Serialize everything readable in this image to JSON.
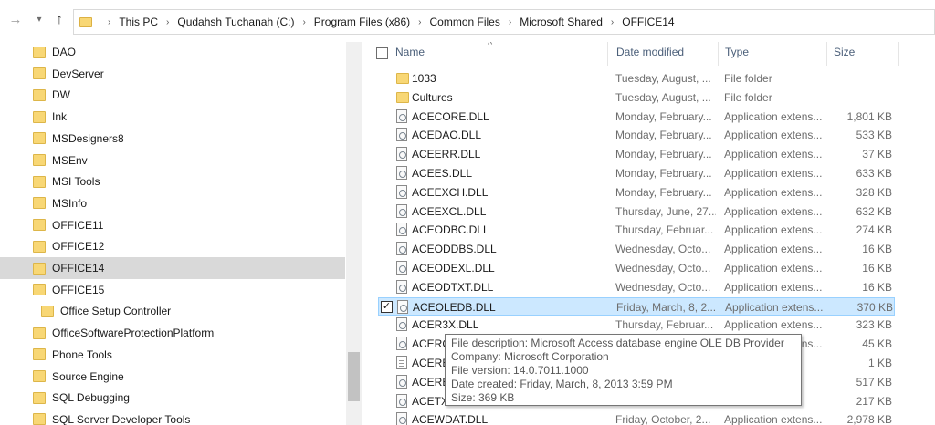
{
  "address": {
    "crumbs": [
      "This PC",
      "Qudahsh Tuchanah (C:)",
      "Program Files (x86)",
      "Common Files",
      "Microsoft Shared",
      "OFFICE14"
    ]
  },
  "nav_items": [
    {
      "label": "DAO"
    },
    {
      "label": "DevServer"
    },
    {
      "label": "DW"
    },
    {
      "label": "Ink"
    },
    {
      "label": "MSDesigners8"
    },
    {
      "label": "MSEnv"
    },
    {
      "label": "MSI Tools"
    },
    {
      "label": "MSInfo"
    },
    {
      "label": "OFFICE11"
    },
    {
      "label": "OFFICE12"
    },
    {
      "label": "OFFICE14",
      "selected": true
    },
    {
      "label": "OFFICE15"
    },
    {
      "label": "Office Setup Controller",
      "indent": true
    },
    {
      "label": "OfficeSoftwareProtectionPlatform"
    },
    {
      "label": "Phone Tools"
    },
    {
      "label": "Source Engine"
    },
    {
      "label": "SQL Debugging"
    },
    {
      "label": "SQL Server Developer Tools"
    }
  ],
  "columns": {
    "name": "Name",
    "date": "Date modified",
    "type": "Type",
    "size": "Size"
  },
  "files": [
    {
      "icon": "folder-icon",
      "name": "1033",
      "date": "Tuesday, August, ...",
      "type": "File folder",
      "size": ""
    },
    {
      "icon": "folder-icon",
      "name": "Cultures",
      "date": "Tuesday, August, ...",
      "type": "File folder",
      "size": ""
    },
    {
      "icon": "dll-file-icon",
      "name": "ACECORE.DLL",
      "date": "Monday, February...",
      "type": "Application extens...",
      "size": "1,801 KB"
    },
    {
      "icon": "dll-file-icon",
      "name": "ACEDAO.DLL",
      "date": "Monday, February...",
      "type": "Application extens...",
      "size": "533 KB"
    },
    {
      "icon": "dll-file-icon",
      "name": "ACEERR.DLL",
      "date": "Monday, February...",
      "type": "Application extens...",
      "size": "37 KB"
    },
    {
      "icon": "dll-file-icon",
      "name": "ACEES.DLL",
      "date": "Monday, February...",
      "type": "Application extens...",
      "size": "633 KB"
    },
    {
      "icon": "dll-file-icon",
      "name": "ACEEXCH.DLL",
      "date": "Monday, February...",
      "type": "Application extens...",
      "size": "328 KB"
    },
    {
      "icon": "dll-file-icon",
      "name": "ACEEXCL.DLL",
      "date": "Thursday, June, 27...",
      "type": "Application extens...",
      "size": "632 KB"
    },
    {
      "icon": "dll-file-icon",
      "name": "ACEODBC.DLL",
      "date": "Thursday, Februar...",
      "type": "Application extens...",
      "size": "274 KB"
    },
    {
      "icon": "dll-file-icon",
      "name": "ACEODDBS.DLL",
      "date": "Wednesday, Octo...",
      "type": "Application extens...",
      "size": "16 KB"
    },
    {
      "icon": "dll-file-icon",
      "name": "ACEODEXL.DLL",
      "date": "Wednesday, Octo...",
      "type": "Application extens...",
      "size": "16 KB"
    },
    {
      "icon": "dll-file-icon",
      "name": "ACEODTXT.DLL",
      "date": "Wednesday, Octo...",
      "type": "Application extens...",
      "size": "16 KB"
    },
    {
      "icon": "dll-file-icon",
      "name": "ACEOLEDB.DLL",
      "date": "Friday, March, 8, 2...",
      "type": "Application extens...",
      "size": "370 KB",
      "selected": true
    },
    {
      "icon": "dll-file-icon",
      "name": "ACER3X.DLL",
      "date": "Thursday, Februar...",
      "type": "Application extens...",
      "size": "323 KB"
    },
    {
      "icon": "dll-file-icon",
      "name": "ACERCLR.DLL",
      "date": "Monday, February...",
      "type": "Application extens...",
      "size": "45 KB"
    },
    {
      "icon": "text-file-icon",
      "name": "ACEREDST",
      "date": "",
      "type": "",
      "size": "1 KB"
    },
    {
      "icon": "dll-file-icon",
      "name": "ACEREP.DLL",
      "date": "",
      "type": "",
      "size": "517 KB"
    },
    {
      "icon": "dll-file-icon",
      "name": "ACETXT.DLL",
      "date": "",
      "type": "",
      "size": "217 KB"
    },
    {
      "icon": "dll-file-icon",
      "name": "ACEWDAT.DLL",
      "date": "Friday, October, 2...",
      "type": "Application extens...",
      "size": "2,978 KB"
    }
  ],
  "tooltip": {
    "lines": [
      "File description: Microsoft Access database engine OLE DB Provider",
      "Company: Microsoft Corporation",
      "File version: 14.0.7011.1000",
      "Date created: Friday, March, 8, 2013 3:59 PM",
      "Size: 369 KB"
    ]
  },
  "selected_check": "✓",
  "colors": {
    "selection": "#cce8ff",
    "selection_border": "#99d1ff",
    "folder": "#f8d775",
    "header_text": "#4c607a"
  }
}
